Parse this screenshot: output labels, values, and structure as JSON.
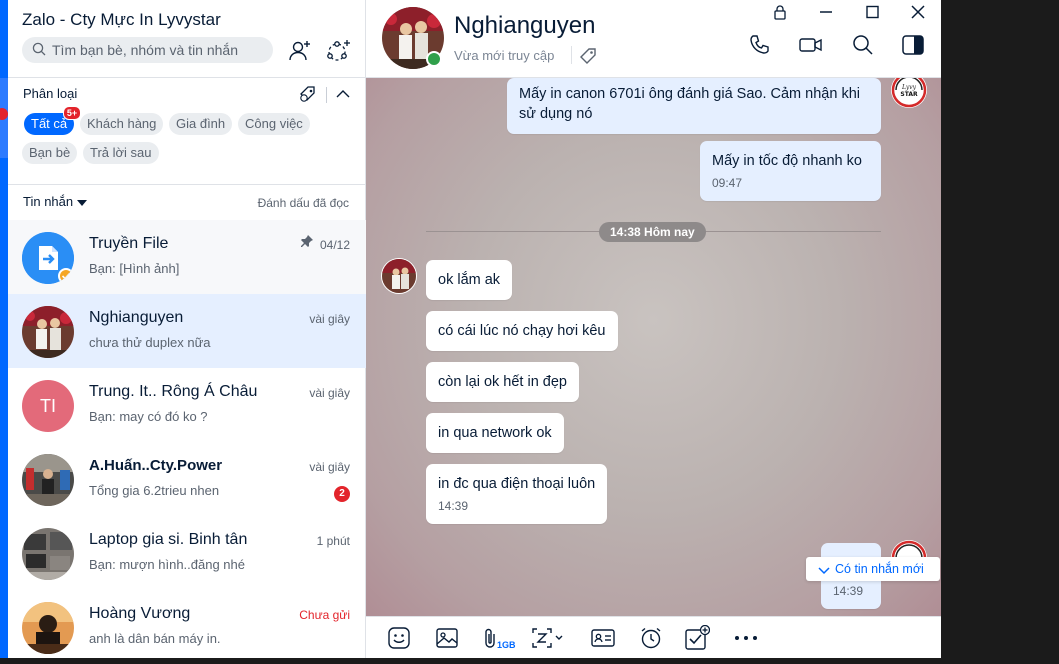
{
  "app": {
    "title": "Zalo - Cty Mực In Lyvystar"
  },
  "search": {
    "placeholder": "Tìm bạn bè, nhóm và tin nhắn"
  },
  "categories": {
    "title": "Phân loại",
    "chips": [
      {
        "label": "Tất cả",
        "active": true,
        "badge": "5+"
      },
      {
        "label": "Khách hàng"
      },
      {
        "label": "Gia đình"
      },
      {
        "label": "Công việc"
      },
      {
        "label": "Bạn bè"
      },
      {
        "label": "Trả lời sau"
      }
    ]
  },
  "messages_header": {
    "label": "Tin nhắn",
    "mark_read": "Đánh dấu đã đọc"
  },
  "conversations": [
    {
      "name": "Truyền File",
      "preview": "Bạn: [Hình ảnh]",
      "time": "04/12",
      "pinned": true
    },
    {
      "name": "Nghianguyen",
      "preview": "chưa thử duplex nữa",
      "time": "vài giây",
      "selected": true
    },
    {
      "name": "Trung. It.. Rông Á Châu",
      "preview": "Bạn: may có đó ko ?",
      "time": "vài giây",
      "initials": "TI"
    },
    {
      "name": "A.Huấn..Cty.Power",
      "preview": "Tổng gia 6.2trieu nhen",
      "time": "vài giây",
      "unread": "2"
    },
    {
      "name": "Laptop gia si. Binh tân",
      "preview": "Bạn: mượn hình..đăng nhé",
      "time": "1 phút"
    },
    {
      "name": "Hoàng Vương",
      "preview": "anh là dân bán máy in.",
      "time": "Chưa gửi"
    }
  ],
  "chat": {
    "name": "Nghianguyen",
    "status": "Vừa mới truy cập",
    "messages": [
      {
        "from": "me",
        "text": "Mấy in canon 6701i ông đánh giá Sao. Cảm nhận khi sử dụng nó"
      },
      {
        "from": "me",
        "text": "Mấy in tốc độ nhanh ko",
        "time": "09:47"
      },
      {
        "divider": "14:38 Hôm nay"
      },
      {
        "from": "them",
        "text": "ok lắm ak"
      },
      {
        "from": "them",
        "text": "có cái lúc nó chạy hơi kêu"
      },
      {
        "from": "them",
        "text": "còn lại ok hết in đẹp"
      },
      {
        "from": "them",
        "text": "in qua network ok"
      },
      {
        "from": "them",
        "text": "in đc qua điện thoại luôn",
        "time": "14:39"
      },
      {
        "from": "me",
        "text": "",
        "time": "14:39"
      }
    ],
    "new_message_notice": "Có tin nhắn mới",
    "badge_text": [
      "Lyvy",
      "STAR"
    ]
  },
  "toolbar": {
    "file_size_label": "1GB"
  },
  "colors": {
    "accent": "#0068ff",
    "danger": "#e3242b",
    "online": "#30a04b",
    "my_bubble": "#e5efff"
  }
}
